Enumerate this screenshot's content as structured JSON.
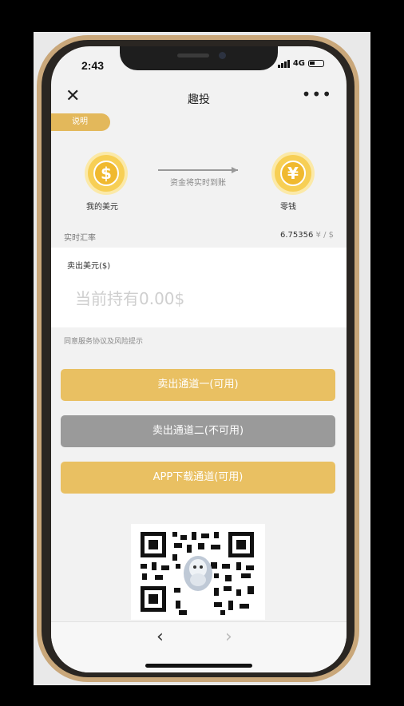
{
  "status_bar": {
    "time": "2:43",
    "network": "4G"
  },
  "nav": {
    "close_icon": "close-icon",
    "title": "趣投",
    "more_icon": "more-icon",
    "more_glyph": "•••"
  },
  "tag": {
    "label": "说明"
  },
  "coins": {
    "left": {
      "symbol": "$",
      "label": "我的美元"
    },
    "right": {
      "symbol": "¥",
      "label": "零钱"
    }
  },
  "transfer": {
    "text": "资金将实时到账"
  },
  "rate": {
    "label": "实时汇率",
    "value": "6.75356",
    "unit": "¥ / $"
  },
  "sell_panel": {
    "label": "卖出美元($)",
    "placeholder": "当前持有0.00$"
  },
  "agreement": {
    "text": "同意服务协议及风险提示"
  },
  "buttons": {
    "channel_one": "卖出通道一(可用)",
    "channel_two": "卖出通道二(不可用)",
    "app_download": "APP下载通道(可用)"
  },
  "browser_nav": {
    "back_glyph": "‹",
    "forward_glyph": "›"
  },
  "colors": {
    "accent_gold": "#e9c062",
    "disabled_gray": "#9a9a9a",
    "coin_yellow": "#f7cf55"
  }
}
